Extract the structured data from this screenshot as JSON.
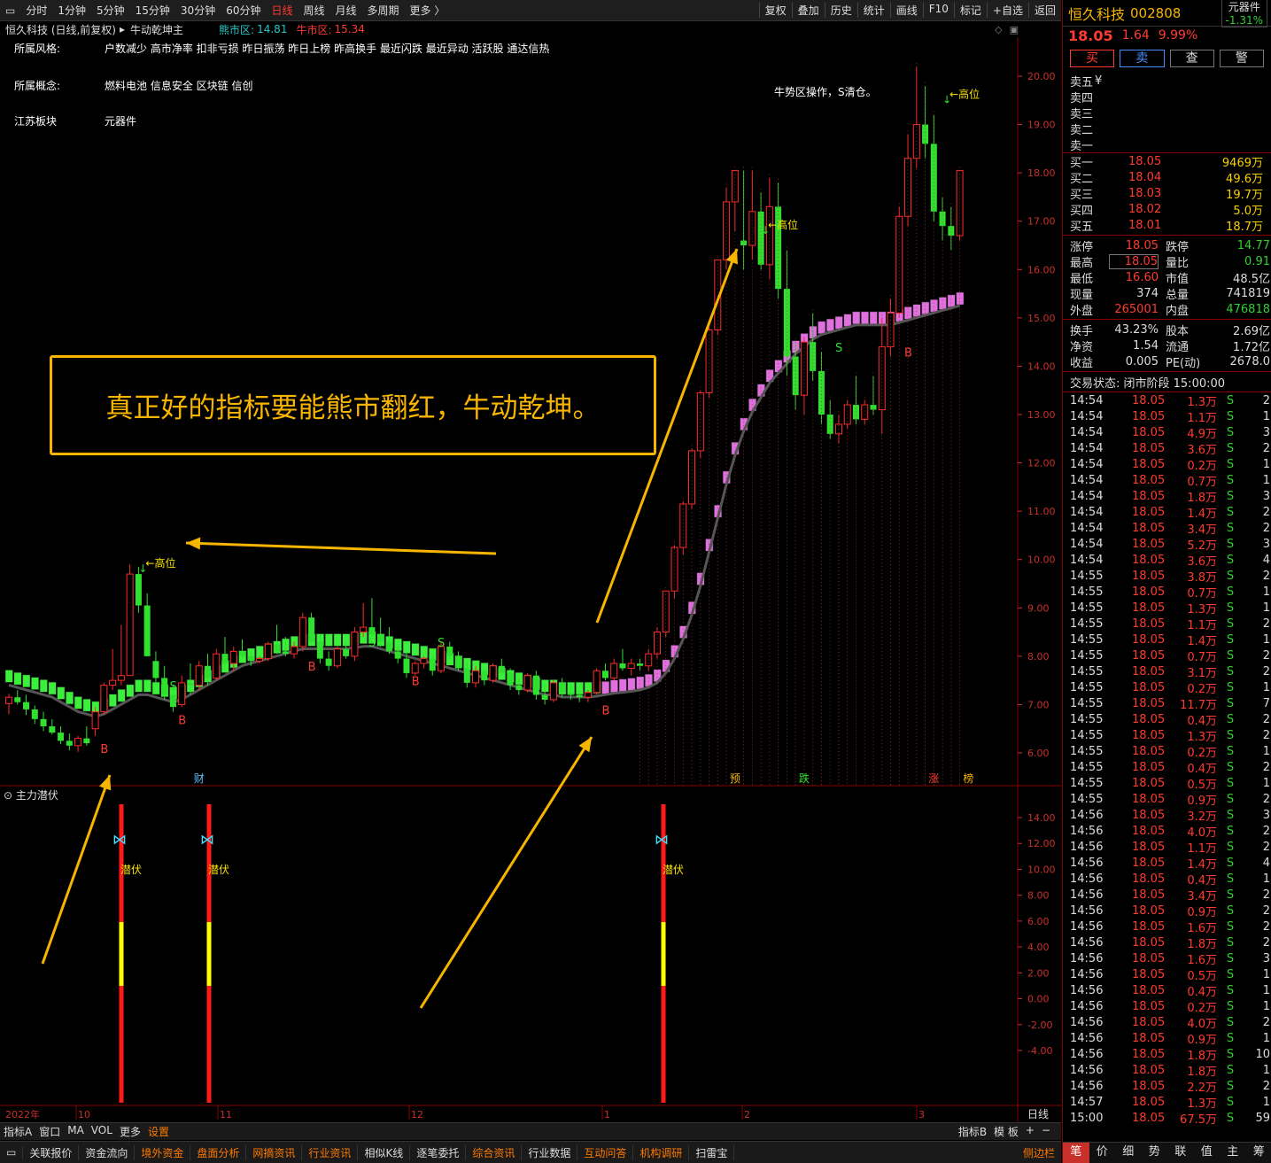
{
  "toolbar": {
    "periods": [
      "分时",
      "1分钟",
      "5分钟",
      "15分钟",
      "30分钟",
      "60分钟",
      "日线",
      "周线",
      "月线",
      "多周期",
      "更多 〉"
    ],
    "active": "日线",
    "right_items": [
      "复权",
      "叠加",
      "历史",
      "统计",
      "画线",
      "F10",
      "标记",
      "+自选",
      "返回"
    ]
  },
  "title": {
    "name": "恒久科技 (日线,前复权)",
    "indicator": "牛动乾坤主",
    "bear_label": "熊市区:",
    "bear_value": "14.81",
    "bull_label": "牛市区:",
    "bull_value": "15.34"
  },
  "info": {
    "style_label": "所属风格:",
    "style_value": "户数减少 高市净率 扣非亏损 昨日振荡 昨日上榜 昨高换手 最近闪跌 最近异动 活跃股 通达信热",
    "concept_label": "所属概念:",
    "concept_value": "燃料电池 信息安全 区块链 信创",
    "region_label": "江苏板块",
    "region_value": "元器件",
    "bull_note": "牛势区操作，S清仓。"
  },
  "callout": "真正好的指标要能熊市翻红，牛动乾坤。",
  "price_ticks": [
    "20.00",
    "19.00",
    "18.00",
    "17.00",
    "16.00",
    "15.00",
    "14.00",
    "13.00",
    "12.00",
    "11.00",
    "10.00",
    "9.00",
    "8.00",
    "7.00",
    "6.00"
  ],
  "sub_ticks": [
    "14.00",
    "12.00",
    "10.00",
    "8.00",
    "6.00",
    "4.00",
    "2.00",
    "0.00",
    "-2.00",
    "-4.00"
  ],
  "sub_title": "主力潜伏",
  "sub_signal": "潜伏",
  "high_label": "←高位",
  "signals": {
    "B": "B",
    "S": "S"
  },
  "event_tags": [
    "财",
    "预",
    "跌",
    "涨",
    "榜"
  ],
  "x_axis": [
    "2022年",
    "10",
    "11",
    "12",
    "1",
    "2",
    "3"
  ],
  "period_label": "日线",
  "bottom1": [
    "指标A",
    "窗口",
    "MA",
    "VOL",
    "更多",
    "设置"
  ],
  "bottom1_right": [
    "指标B",
    "模 板",
    "+",
    "−"
  ],
  "bottom2": [
    "关联报价",
    "资金流向",
    "境外资金",
    "盘面分析",
    "网摘资讯",
    "行业资讯",
    "相似K线",
    "逐笔委托",
    "综合资讯",
    "行业数据",
    "互动问答",
    "机构调研",
    "扫雷宝"
  ],
  "bottom2_hl": [
    "境外资金",
    "盘面分析",
    "网摘资讯",
    "行业资讯",
    "综合资讯",
    "互动问答",
    "机构调研"
  ],
  "bottom2_right": "侧边栏",
  "stock": {
    "name": "恒久科技",
    "code": "002808",
    "sector": "元器件",
    "sector_change": "-1.31%",
    "price": "18.05",
    "change": "1.64",
    "pct": "9.99%",
    "buttons": [
      "买",
      "卖",
      "查",
      "警"
    ]
  },
  "asks": [
    {
      "label": "卖五",
      "price": "¥",
      "vol": ""
    },
    {
      "label": "卖四",
      "price": "",
      "vol": ""
    },
    {
      "label": "卖三",
      "price": "",
      "vol": ""
    },
    {
      "label": "卖二",
      "price": "",
      "vol": ""
    },
    {
      "label": "卖一",
      "price": "",
      "vol": ""
    }
  ],
  "bids": [
    {
      "label": "买一",
      "price": "18.05",
      "vol": "9469万"
    },
    {
      "label": "买二",
      "price": "18.04",
      "vol": "49.6万"
    },
    {
      "label": "买三",
      "price": "18.03",
      "vol": "19.7万"
    },
    {
      "label": "买四",
      "price": "18.02",
      "vol": "5.0万"
    },
    {
      "label": "买五",
      "price": "18.01",
      "vol": "18.7万"
    }
  ],
  "stats": [
    [
      "涨停",
      "18.05",
      "跌停",
      "14.77"
    ],
    [
      "最高",
      "18.05",
      "量比",
      "0.91"
    ],
    [
      "最低",
      "16.60",
      "市值",
      "48.5亿"
    ],
    [
      "现量",
      "374",
      "总量",
      "741819"
    ],
    [
      "外盘",
      "265001",
      "内盘",
      "476818"
    ]
  ],
  "stats2": [
    [
      "换手",
      "43.23%",
      "股本",
      "2.69亿"
    ],
    [
      "净资",
      "1.54",
      "流通",
      "1.72亿"
    ],
    [
      "收益",
      "0.005",
      "PE(动)",
      "2678.0"
    ]
  ],
  "trade_status": "交易状态: 闭市阶段 15:00:00",
  "trades": [
    [
      "14:54",
      "18.05",
      "1.3万",
      "S",
      "2"
    ],
    [
      "14:54",
      "18.05",
      "1.1万",
      "S",
      "1"
    ],
    [
      "14:54",
      "18.05",
      "4.9万",
      "S",
      "3"
    ],
    [
      "14:54",
      "18.05",
      "3.6万",
      "S",
      "2"
    ],
    [
      "14:54",
      "18.05",
      "0.2万",
      "S",
      "1"
    ],
    [
      "14:54",
      "18.05",
      "0.7万",
      "S",
      "1"
    ],
    [
      "14:54",
      "18.05",
      "1.8万",
      "S",
      "3"
    ],
    [
      "14:54",
      "18.05",
      "1.4万",
      "S",
      "2"
    ],
    [
      "14:54",
      "18.05",
      "3.4万",
      "S",
      "2"
    ],
    [
      "14:54",
      "18.05",
      "5.2万",
      "S",
      "3"
    ],
    [
      "14:54",
      "18.05",
      "3.6万",
      "S",
      "4"
    ],
    [
      "14:55",
      "18.05",
      "3.8万",
      "S",
      "2"
    ],
    [
      "14:55",
      "18.05",
      "0.7万",
      "S",
      "1"
    ],
    [
      "14:55",
      "18.05",
      "1.3万",
      "S",
      "1"
    ],
    [
      "14:55",
      "18.05",
      "1.1万",
      "S",
      "2"
    ],
    [
      "14:55",
      "18.05",
      "1.4万",
      "S",
      "1"
    ],
    [
      "14:55",
      "18.05",
      "0.7万",
      "S",
      "2"
    ],
    [
      "14:55",
      "18.05",
      "3.1万",
      "S",
      "2"
    ],
    [
      "14:55",
      "18.05",
      "0.2万",
      "S",
      "1"
    ],
    [
      "14:55",
      "18.05",
      "11.7万",
      "S",
      "7"
    ],
    [
      "14:55",
      "18.05",
      "0.4万",
      "S",
      "2"
    ],
    [
      "14:55",
      "18.05",
      "1.3万",
      "S",
      "2"
    ],
    [
      "14:55",
      "18.05",
      "0.2万",
      "S",
      "1"
    ],
    [
      "14:55",
      "18.05",
      "0.4万",
      "S",
      "2"
    ],
    [
      "14:55",
      "18.05",
      "0.5万",
      "S",
      "1"
    ],
    [
      "14:55",
      "18.05",
      "0.9万",
      "S",
      "2"
    ],
    [
      "14:56",
      "18.05",
      "3.2万",
      "S",
      "3"
    ],
    [
      "14:56",
      "18.05",
      "4.0万",
      "S",
      "2"
    ],
    [
      "14:56",
      "18.05",
      "1.1万",
      "S",
      "2"
    ],
    [
      "14:56",
      "18.05",
      "1.4万",
      "S",
      "4"
    ],
    [
      "14:56",
      "18.05",
      "0.4万",
      "S",
      "1"
    ],
    [
      "14:56",
      "18.05",
      "3.4万",
      "S",
      "2"
    ],
    [
      "14:56",
      "18.05",
      "0.9万",
      "S",
      "2"
    ],
    [
      "14:56",
      "18.05",
      "1.6万",
      "S",
      "2"
    ],
    [
      "14:56",
      "18.05",
      "1.8万",
      "S",
      "2"
    ],
    [
      "14:56",
      "18.05",
      "1.6万",
      "S",
      "3"
    ],
    [
      "14:56",
      "18.05",
      "0.5万",
      "S",
      "1"
    ],
    [
      "14:56",
      "18.05",
      "0.4万",
      "S",
      "1"
    ],
    [
      "14:56",
      "18.05",
      "0.2万",
      "S",
      "1"
    ],
    [
      "14:56",
      "18.05",
      "4.0万",
      "S",
      "2"
    ],
    [
      "14:56",
      "18.05",
      "0.9万",
      "S",
      "1"
    ],
    [
      "14:56",
      "18.05",
      "1.8万",
      "S",
      "10"
    ],
    [
      "14:56",
      "18.05",
      "1.8万",
      "S",
      "1"
    ],
    [
      "14:56",
      "18.05",
      "2.2万",
      "S",
      "2"
    ],
    [
      "14:57",
      "18.05",
      "1.3万",
      "S",
      "1"
    ],
    [
      "15:00",
      "18.05",
      "67.5万",
      "S",
      "59"
    ]
  ],
  "tabs": [
    "笔",
    "价",
    "细",
    "势",
    "联",
    "值",
    "主",
    "筹"
  ],
  "chart_data": {
    "type": "candlestick",
    "y_range": [
      5.5,
      20.5
    ],
    "candles": [
      [
        7.02,
        7.22,
        6.8,
        7.15
      ],
      [
        7.15,
        7.3,
        7.0,
        7.05
      ],
      [
        7.05,
        7.2,
        6.78,
        6.9
      ],
      [
        6.9,
        6.98,
        6.6,
        6.7
      ],
      [
        6.7,
        6.85,
        6.45,
        6.55
      ],
      [
        6.55,
        6.7,
        6.38,
        6.42
      ],
      [
        6.42,
        6.55,
        6.18,
        6.25
      ],
      [
        6.25,
        6.4,
        6.05,
        6.15
      ],
      [
        6.15,
        6.35,
        6.02,
        6.3
      ],
      [
        6.3,
        6.55,
        6.15,
        6.2
      ],
      [
        6.5,
        6.95,
        6.35,
        6.85
      ],
      [
        6.85,
        7.45,
        6.8,
        7.4
      ],
      [
        7.4,
        8.15,
        7.3,
        7.5
      ],
      [
        7.5,
        8.65,
        7.4,
        7.6
      ],
      [
        7.6,
        9.9,
        7.6,
        9.7
      ],
      [
        9.7,
        9.85,
        8.9,
        9.05
      ],
      [
        9.05,
        9.3,
        8.0,
        8.0
      ],
      [
        7.9,
        8.1,
        7.4,
        7.55
      ],
      [
        7.55,
        7.8,
        7.1,
        7.2
      ],
      [
        7.2,
        7.4,
        6.85,
        6.95
      ],
      [
        7.0,
        7.6,
        6.95,
        7.45
      ],
      [
        7.45,
        7.85,
        7.2,
        7.4
      ],
      [
        7.4,
        7.9,
        7.3,
        7.8
      ],
      [
        7.8,
        8.05,
        7.4,
        7.55
      ],
      [
        7.55,
        8.15,
        7.5,
        8.05
      ],
      [
        8.05,
        8.4,
        7.8,
        7.85
      ],
      [
        7.85,
        8.2,
        7.7,
        8.1
      ],
      [
        8.1,
        8.35,
        7.95,
        8.0
      ],
      [
        8.0,
        8.1,
        7.8,
        7.9
      ],
      [
        7.9,
        8.0,
        7.85,
        7.95
      ],
      [
        7.95,
        8.3,
        7.9,
        8.25
      ],
      [
        8.25,
        8.65,
        8.05,
        8.1
      ],
      [
        8.1,
        8.4,
        8.0,
        8.05
      ],
      [
        8.05,
        8.3,
        7.95,
        8.2
      ],
      [
        8.2,
        8.9,
        8.1,
        8.8
      ],
      [
        8.8,
        8.9,
        8.25,
        8.3
      ],
      [
        8.3,
        8.45,
        7.85,
        7.95
      ],
      [
        7.95,
        8.1,
        7.7,
        7.8
      ],
      [
        7.8,
        8.2,
        7.75,
        8.15
      ],
      [
        8.15,
        8.3,
        7.95,
        8.0
      ],
      [
        8.0,
        8.6,
        7.9,
        8.5
      ],
      [
        8.5,
        9.1,
        8.4,
        8.6
      ],
      [
        8.6,
        9.2,
        8.4,
        8.45
      ],
      [
        8.45,
        8.8,
        8.2,
        8.3
      ],
      [
        8.3,
        8.6,
        8.05,
        8.1
      ],
      [
        8.1,
        8.2,
        7.85,
        7.95
      ],
      [
        7.95,
        8.1,
        7.55,
        7.65
      ],
      [
        7.65,
        7.9,
        7.6,
        7.85
      ],
      [
        7.85,
        8.0,
        7.75,
        7.95
      ],
      [
        7.95,
        8.0,
        7.6,
        7.7
      ],
      [
        7.7,
        8.3,
        7.65,
        8.2
      ],
      [
        8.2,
        8.3,
        7.95,
        8.0
      ],
      [
        8.0,
        8.1,
        7.7,
        7.75
      ],
      [
        7.75,
        7.9,
        7.35,
        7.45
      ],
      [
        7.45,
        7.8,
        7.35,
        7.7
      ],
      [
        7.7,
        7.75,
        7.4,
        7.5
      ],
      [
        7.5,
        7.85,
        7.45,
        7.8
      ],
      [
        7.8,
        7.95,
        7.6,
        7.65
      ],
      [
        7.65,
        7.75,
        7.3,
        7.4
      ],
      [
        7.4,
        7.55,
        7.2,
        7.3
      ],
      [
        7.3,
        7.65,
        7.25,
        7.6
      ],
      [
        7.6,
        7.7,
        7.1,
        7.2
      ],
      [
        7.2,
        7.4,
        7.0,
        7.1
      ],
      [
        7.1,
        7.5,
        7.05,
        7.45
      ],
      [
        7.45,
        7.55,
        7.15,
        7.25
      ],
      [
        7.25,
        7.4,
        7.1,
        7.2
      ],
      [
        7.2,
        7.3,
        7.05,
        7.15
      ],
      [
        7.15,
        7.3,
        7.05,
        7.25
      ],
      [
        7.25,
        7.75,
        7.2,
        7.7
      ],
      [
        7.7,
        7.85,
        7.5,
        7.55
      ],
      [
        7.55,
        7.95,
        7.5,
        7.85
      ],
      [
        7.85,
        8.15,
        7.7,
        7.75
      ],
      [
        7.75,
        7.95,
        7.6,
        7.85
      ],
      [
        7.85,
        7.95,
        7.7,
        7.8
      ],
      [
        7.8,
        8.15,
        7.7,
        8.05
      ],
      [
        8.05,
        8.6,
        7.95,
        8.5
      ],
      [
        8.5,
        9.35,
        8.4,
        9.35
      ],
      [
        9.35,
        10.3,
        9.2,
        10.25
      ],
      [
        10.25,
        11.2,
        10.1,
        11.15
      ],
      [
        11.15,
        12.3,
        11.05,
        12.25
      ],
      [
        12.25,
        13.5,
        12.1,
        13.45
      ],
      [
        13.45,
        14.8,
        13.35,
        14.75
      ],
      [
        14.75,
        16.2,
        14.65,
        16.2
      ],
      [
        16.2,
        17.7,
        16.0,
        17.4
      ],
      [
        17.4,
        18.05,
        16.8,
        18.05
      ],
      [
        16.6,
        18.05,
        16.0,
        16.5
      ],
      [
        16.5,
        18.05,
        16.2,
        17.2
      ],
      [
        17.2,
        17.6,
        16.0,
        16.1
      ],
      [
        16.1,
        17.9,
        15.8,
        17.3
      ],
      [
        17.3,
        17.8,
        15.4,
        15.6
      ],
      [
        15.6,
        16.4,
        13.8,
        14.2
      ],
      [
        14.2,
        14.5,
        13.1,
        13.4
      ],
      [
        13.4,
        14.6,
        13.0,
        14.5
      ],
      [
        14.5,
        15.1,
        13.7,
        13.9
      ],
      [
        13.9,
        14.3,
        12.8,
        13.0
      ],
      [
        13.0,
        13.3,
        12.5,
        12.6
      ],
      [
        12.6,
        13.0,
        12.4,
        12.8
      ],
      [
        12.8,
        13.3,
        12.7,
        13.2
      ],
      [
        13.2,
        13.8,
        12.8,
        12.9
      ],
      [
        12.9,
        13.3,
        12.8,
        13.2
      ],
      [
        13.2,
        13.8,
        13.0,
        13.1
      ],
      [
        13.1,
        15.0,
        12.6,
        14.4
      ],
      [
        14.4,
        15.4,
        14.2,
        15.1
      ],
      [
        15.1,
        17.3,
        15.0,
        17.1
      ],
      [
        17.1,
        18.8,
        16.9,
        18.3
      ],
      [
        18.3,
        20.2,
        18.1,
        19.0
      ],
      [
        19.0,
        19.8,
        18.3,
        18.6
      ],
      [
        18.6,
        19.2,
        17.0,
        17.2
      ],
      [
        17.2,
        17.5,
        16.6,
        16.9
      ],
      [
        16.9,
        17.3,
        16.4,
        16.7
      ],
      [
        16.7,
        18.05,
        16.6,
        18.05
      ]
    ],
    "band_mid": [
      7.55,
      7.5,
      7.45,
      7.4,
      7.35,
      7.3,
      7.2,
      7.1,
      7.0,
      6.95,
      6.9,
      6.95,
      7.05,
      7.15,
      7.25,
      7.35,
      7.35,
      7.3,
      7.25,
      7.2,
      7.25,
      7.35,
      7.45,
      7.55,
      7.65,
      7.75,
      7.85,
      7.95,
      8.0,
      8.05,
      8.1,
      8.15,
      8.2,
      8.25,
      8.3,
      8.3,
      8.3,
      8.3,
      8.3,
      8.3,
      8.32,
      8.35,
      8.35,
      8.3,
      8.25,
      8.2,
      8.15,
      8.1,
      8.05,
      8.0,
      7.95,
      7.9,
      7.85,
      7.8,
      7.75,
      7.7,
      7.65,
      7.6,
      7.55,
      7.5,
      7.45,
      7.4,
      7.35,
      7.35,
      7.3,
      7.3,
      7.3,
      7.3,
      7.32,
      7.35,
      7.38,
      7.4,
      7.42,
      7.45,
      7.5,
      7.6,
      7.8,
      8.1,
      8.5,
      9.0,
      9.6,
      10.3,
      11.0,
      11.7,
      12.3,
      12.8,
      13.2,
      13.5,
      13.8,
      14.0,
      14.2,
      14.4,
      14.55,
      14.7,
      14.8,
      14.85,
      14.9,
      14.95,
      15.0,
      15.0,
      15.0,
      15.0,
      15.0,
      15.05,
      15.1,
      15.15,
      15.2,
      15.25,
      15.3,
      15.35,
      15.4
    ],
    "bull_from_index": 69,
    "sub_spikes_index": [
      12,
      21,
      69
    ]
  }
}
